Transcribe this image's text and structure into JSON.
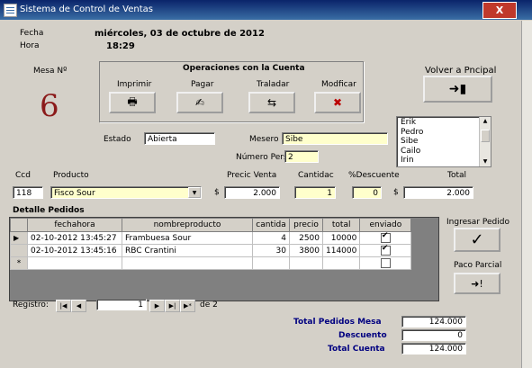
{
  "window": {
    "title": "Sistema de Control de Ventas",
    "close_label": "X"
  },
  "header": {
    "fecha_label": "Fecha",
    "fecha_value": "miércoles, 03 de octubre de 2012",
    "hora_label": "Hora",
    "hora_value": "18:29"
  },
  "mesa": {
    "label": "Mesa Nº",
    "number": "6"
  },
  "operations": {
    "title": "Operaciones con la Cuenta",
    "imprimir": "Imprimir",
    "pagar": "Pagar",
    "trasladar": "Traladar",
    "modificar": "Modficar"
  },
  "volver_label": "Volver a Pncipal",
  "estado": {
    "label": "Estado",
    "value": "Abierta"
  },
  "mesero": {
    "label": "Mesero",
    "value": "Sibe"
  },
  "personas": {
    "label": "Número Personas",
    "value": "2"
  },
  "mesero_list": [
    "Erik",
    "Pedro",
    "Sibe",
    "Cailo",
    "Irin"
  ],
  "product_row": {
    "cod_label": "Ccd",
    "cod_value": "118",
    "producto_label": "Producto",
    "producto_value": "Fisco Sour",
    "precio_label": "Precic Venta",
    "precio_currency": "$",
    "precio_value": "2.000",
    "cantidad_label": "Cantidac",
    "cantidad_value": "1",
    "descuento_label": "%Descuente",
    "descuento_value": "0",
    "total_label": "Total",
    "total_currency": "$",
    "total_value": "2.000"
  },
  "detalle": {
    "label": "Detalle Pedidos",
    "columns": [
      "fechahora",
      "nombreproducto",
      "cantida",
      "precio",
      "total",
      "enviado"
    ],
    "rows": [
      {
        "indicator": "▶",
        "fechahora": "02-10-2012 13:45:27",
        "nombre": "Frambuesa Sour",
        "cantidad": "4",
        "precio": "2500",
        "total": "10000",
        "enviado": true
      },
      {
        "indicator": "",
        "fechahora": "02-10-2012 13:45:16",
        "nombre": "RBC Crantini",
        "cantidad": "30",
        "precio": "3800",
        "total": "114000",
        "enviado": true
      },
      {
        "indicator": "*",
        "fechahora": "",
        "nombre": "",
        "cantidad": "",
        "precio": "",
        "total": "",
        "enviado": false
      }
    ]
  },
  "navigation": {
    "registro_label": "Registro:",
    "current": "1",
    "of_label": "de 2"
  },
  "ingresar_label": "Ingresar Pedido",
  "pago_parcial_label": "Paco Parcial",
  "totals": {
    "pedidos_label": "Total Pedidos Mesa",
    "pedidos_value": "124.000",
    "descuento_label": "Descuento",
    "descuento_value": "0",
    "cuenta_label": "Total Cuenta",
    "cuenta_value": "124.000"
  },
  "colors": {
    "titlebar": "#0a246a",
    "mesa_number": "#8b1a1a",
    "field_yellow": "#ffffcc",
    "totals_label": "#000080"
  }
}
